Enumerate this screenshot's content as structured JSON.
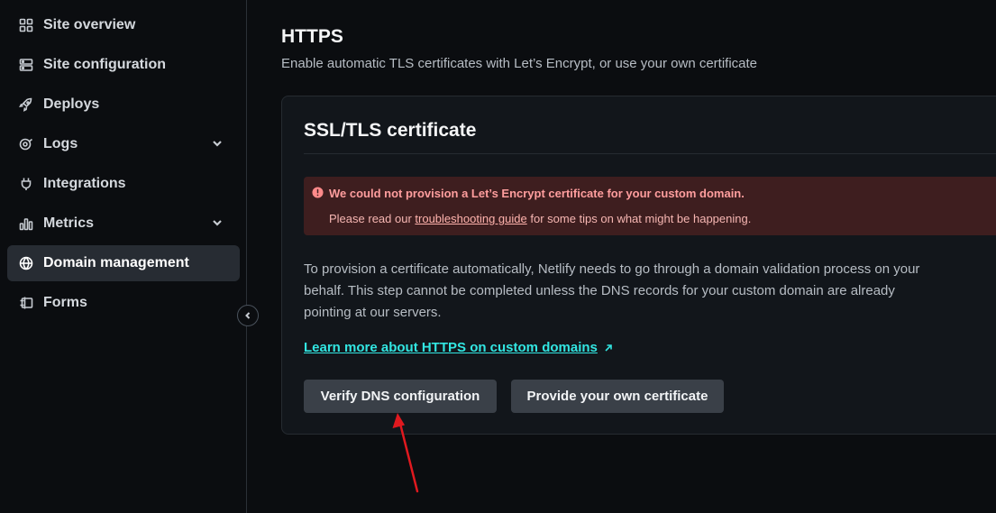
{
  "sidebar": {
    "items": [
      {
        "label": "Site overview",
        "icon": "grid-icon"
      },
      {
        "label": "Site configuration",
        "icon": "settings-list-icon"
      },
      {
        "label": "Deploys",
        "icon": "rocket-icon"
      },
      {
        "label": "Logs",
        "icon": "logs-icon",
        "expandable": true
      },
      {
        "label": "Integrations",
        "icon": "plug-icon"
      },
      {
        "label": "Metrics",
        "icon": "bar-chart-icon",
        "expandable": true
      },
      {
        "label": "Domain management",
        "icon": "globe-icon",
        "active": true
      },
      {
        "label": "Forms",
        "icon": "form-icon"
      }
    ]
  },
  "main": {
    "title": "HTTPS",
    "subtitle": "Enable automatic TLS certificates with Let’s Encrypt, or use your own certificate",
    "card": {
      "title": "SSL/TLS certificate",
      "alert": {
        "title": "We could not provision a Let’s Encrypt certificate for your custom domain.",
        "body_prefix": "Please read our ",
        "link": "troubleshooting guide",
        "body_suffix": " for some tips on what might be happening."
      },
      "description": "To provision a certificate automatically, Netlify needs to go through a domain validation process on your behalf. This step cannot be completed unless the DNS records for your custom domain are already pointing at our servers.",
      "learn_link": "Learn more about HTTPS on custom domains",
      "buttons": {
        "verify": "Verify DNS configuration",
        "own": "Provide your own certificate"
      }
    }
  },
  "colors": {
    "background": "#0b0d10",
    "card": "#12161b",
    "alert_bg": "#3e1e1f",
    "alert_text": "#ff9e9e",
    "link": "#32e6e2",
    "button": "#3a4048",
    "annotation_arrow": "#e0191f"
  }
}
